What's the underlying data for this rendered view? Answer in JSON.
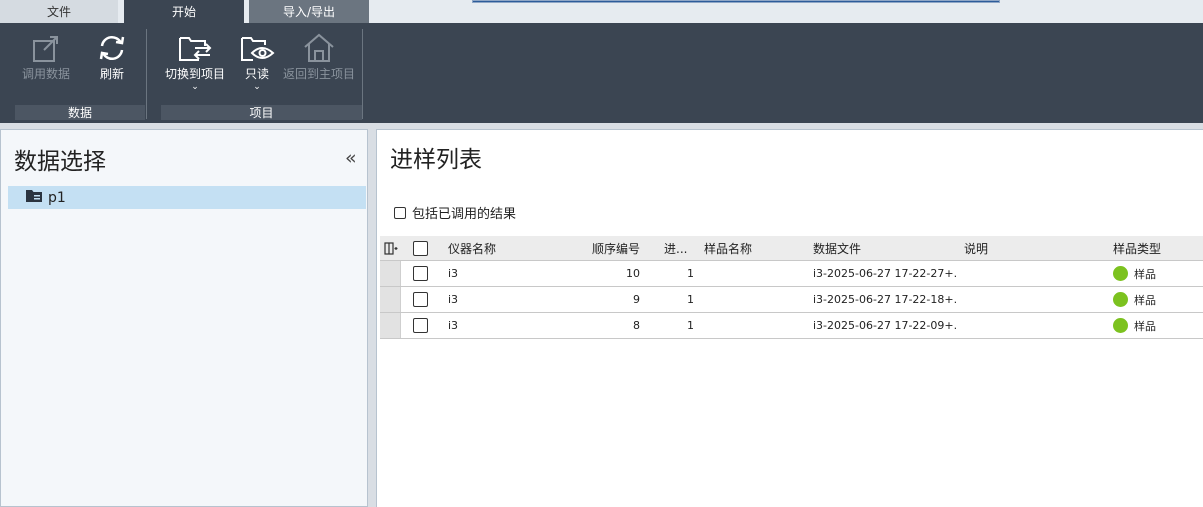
{
  "tabs": {
    "file": "文件",
    "start": "开始",
    "import_export": "导入/导出"
  },
  "ribbon": {
    "load_data": "调用数据",
    "refresh": "刷新",
    "switch_project": "切换到项目",
    "read_only": "只读",
    "return_main": "返回到主项目",
    "group_data": "数据",
    "group_project": "项目"
  },
  "left": {
    "title": "数据选择",
    "collapse_glyph": "«",
    "tree": [
      {
        "label": "p1"
      }
    ]
  },
  "right": {
    "title": "进样列表",
    "include_label": "包括已调用的结果",
    "columns": {
      "instrument": "仪器名称",
      "seq": "顺序编号",
      "inj": "进...",
      "sample_name": "样品名称",
      "data_file": "数据文件",
      "desc": "说明",
      "sample_type": "样品类型"
    },
    "rows": [
      {
        "instrument": "i3",
        "seq": "10",
        "inj": "1",
        "sample_name": "",
        "data_file": "i3-2025-06-27 17-22-27+...",
        "desc": "",
        "sample_type": "样品"
      },
      {
        "instrument": "i3",
        "seq": "9",
        "inj": "1",
        "sample_name": "",
        "data_file": "i3-2025-06-27 17-22-18+...",
        "desc": "",
        "sample_type": "样品"
      },
      {
        "instrument": "i3",
        "seq": "8",
        "inj": "1",
        "sample_name": "",
        "data_file": "i3-2025-06-27 17-22-09+...",
        "desc": "",
        "sample_type": "样品"
      }
    ]
  },
  "colors": {
    "ribbon_bg": "#3b4552",
    "sample_dot": "#7cc21f",
    "tree_selected": "#c4e0f3"
  }
}
